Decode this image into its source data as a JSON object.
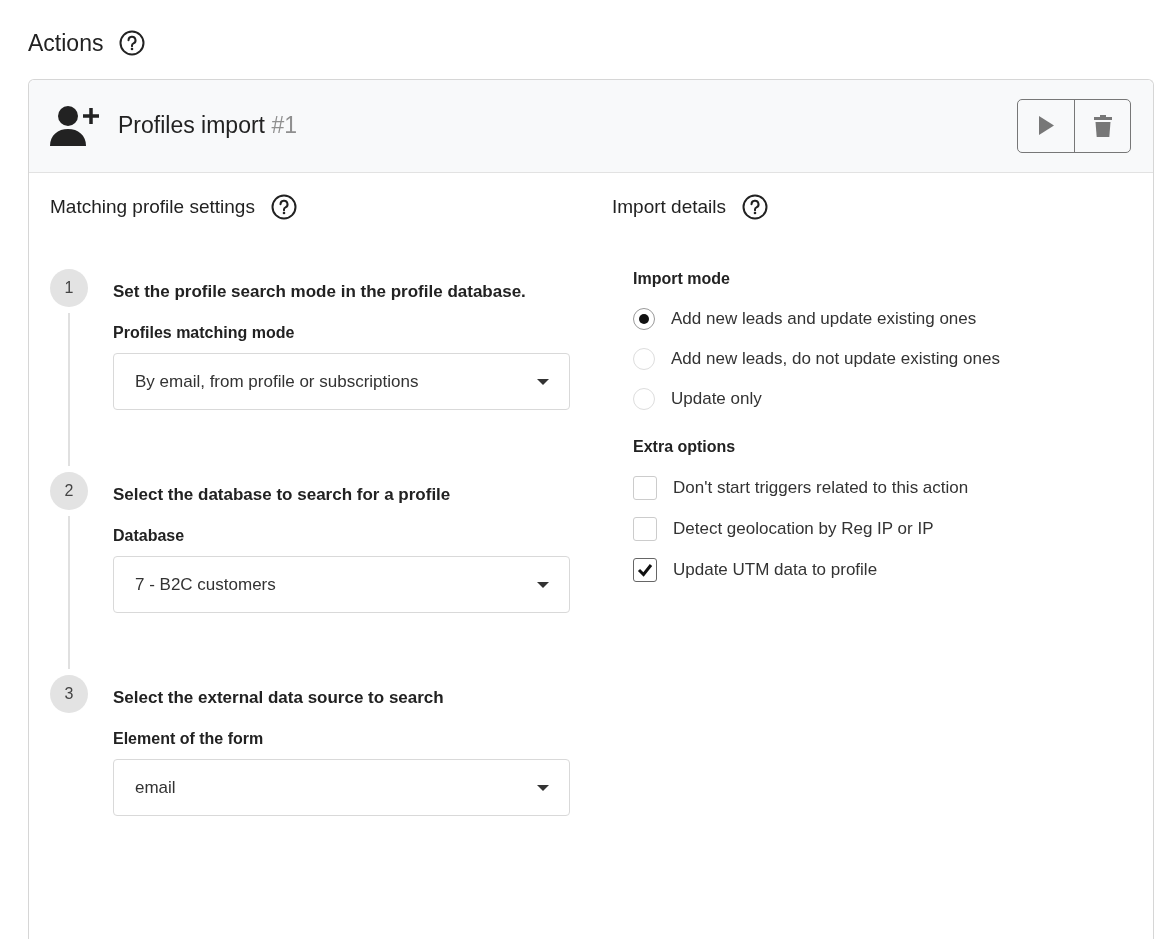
{
  "heading": {
    "title": "Actions"
  },
  "action": {
    "title": "Profiles import",
    "number": "#1",
    "buttons": [
      {
        "kind": "run"
      },
      {
        "kind": "delete"
      }
    ]
  },
  "matching": {
    "title": "Matching profile settings",
    "steps": [
      {
        "number": "1",
        "text": "Set the profile search mode in the profile database.",
        "label": "Profiles matching mode",
        "value": "By email, from profile or subscriptions"
      },
      {
        "number": "2",
        "text": "Select the database to search for a profile",
        "label": "Database",
        "value": "7 - B2C customers"
      },
      {
        "number": "3",
        "text": "Select the external data source to search",
        "label": "Element of the form",
        "value": "email"
      }
    ]
  },
  "import_details": {
    "title": "Import details",
    "mode_label": "Import mode",
    "modes": [
      {
        "label": "Add new leads and update existing ones",
        "selected": true
      },
      {
        "label": "Add new leads, do not update existing ones",
        "selected": false
      },
      {
        "label": "Update only",
        "selected": false
      }
    ],
    "extra_label": "Extra options",
    "options": [
      {
        "label": "Don't start triggers related to this action",
        "checked": false
      },
      {
        "label": "Detect geolocation by Reg IP or IP",
        "checked": false
      },
      {
        "label": "Update UTM data to profile",
        "checked": true
      }
    ]
  }
}
